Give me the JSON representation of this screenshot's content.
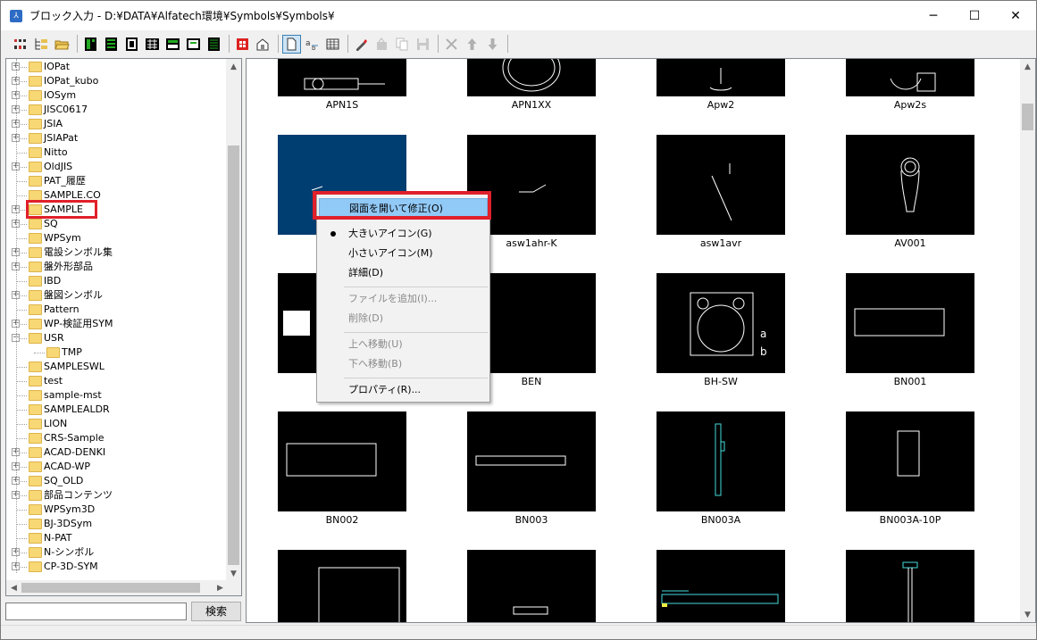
{
  "window": {
    "title": "ブロック入力 - D:¥DATA¥Alfatech環境¥Symbols¥Symbols¥",
    "minimize_glyph": "─",
    "maximize_glyph": "☐",
    "close_glyph": "✕"
  },
  "toolbar": {
    "buttons": [
      "tree-icon",
      "tree-folder-icon",
      "open-folder-icon",
      "green-grid-icon-1",
      "green-grid-icon-2",
      "frame-icon-1",
      "frame-icon-2",
      "frame-icon-3",
      "frame-icon-4",
      "red-symbol-icon",
      "property-icon",
      "large-icon-view-icon",
      "small-icon-view-icon",
      "detail-view-icon",
      "pen-icon",
      "cut-icon",
      "copy-icon",
      "save-icon",
      "delete-icon",
      "move-up-icon",
      "move-down-icon"
    ]
  },
  "tree": {
    "items": [
      {
        "label": "IOPat",
        "expandable": true
      },
      {
        "label": "IOPat_kubo",
        "expandable": true
      },
      {
        "label": "IOSym",
        "expandable": true
      },
      {
        "label": "JISC0617",
        "expandable": true
      },
      {
        "label": "JSIA",
        "expandable": true
      },
      {
        "label": "JSIAPat",
        "expandable": true
      },
      {
        "label": "Nitto",
        "expandable": false
      },
      {
        "label": "OldJIS",
        "expandable": true
      },
      {
        "label": "PAT_履歴",
        "expandable": false
      },
      {
        "label": "SAMPLE.CO",
        "expandable": false
      },
      {
        "label": "SAMPLE",
        "expandable": true
      },
      {
        "label": "SQ",
        "expandable": true
      },
      {
        "label": "WPSym",
        "expandable": false
      },
      {
        "label": "電設シンボル集",
        "expandable": true
      },
      {
        "label": "盤外形部品",
        "expandable": true
      },
      {
        "label": "IBD",
        "expandable": false
      },
      {
        "label": "盤図シンボル",
        "expandable": true
      },
      {
        "label": "Pattern",
        "expandable": false
      },
      {
        "label": "WP-検証用SYM",
        "expandable": true
      },
      {
        "label": "USR",
        "expandable": true,
        "expanded": true
      },
      {
        "label": "TMP",
        "expandable": false,
        "child": true
      },
      {
        "label": "SAMPLESWL",
        "expandable": false
      },
      {
        "label": "test",
        "expandable": false
      },
      {
        "label": "sample-mst",
        "expandable": false
      },
      {
        "label": "SAMPLEALDR",
        "expandable": false
      },
      {
        "label": "LION",
        "expandable": false
      },
      {
        "label": "CRS-Sample",
        "expandable": false
      },
      {
        "label": "ACAD-DENKI",
        "expandable": true
      },
      {
        "label": "ACAD-WP",
        "expandable": true
      },
      {
        "label": "SQ_OLD",
        "expandable": true
      },
      {
        "label": "部品コンテンツ",
        "expandable": true
      },
      {
        "label": "WPSym3D",
        "expandable": false
      },
      {
        "label": "BJ-3DSym",
        "expandable": false
      },
      {
        "label": "N-PAT",
        "expandable": false
      },
      {
        "label": "N-シンボル",
        "expandable": true
      },
      {
        "label": "CP-3D-SYM",
        "expandable": true
      }
    ],
    "highlighted": "SAMPLE"
  },
  "search": {
    "value": "",
    "button_label": "検索"
  },
  "icons": {
    "captions": [
      "APN1S",
      "APN1XX",
      "Apw2",
      "Apw2s",
      "",
      "asw1ahr-K",
      "asw1avr",
      "AV001",
      "",
      "BEN",
      "BH-SW",
      "BN001",
      "BN002",
      "BN003",
      "BN003A",
      "BN003A-10P",
      "",
      "",
      "",
      ""
    ],
    "selected_index": 4
  },
  "context_menu": {
    "items": [
      {
        "label": "図面を開いて修正(O)",
        "state": "hover"
      },
      {
        "label": "大きいアイコン(G)",
        "state": "checked"
      },
      {
        "label": "小さいアイコン(M)",
        "state": "normal"
      },
      {
        "label": "詳細(D)",
        "state": "normal"
      },
      {
        "label": "ファイルを追加(I)...",
        "state": "disabled"
      },
      {
        "label": "削除(D)",
        "state": "disabled"
      },
      {
        "label": "上へ移動(U)",
        "state": "disabled"
      },
      {
        "label": "下へ移動(B)",
        "state": "disabled"
      },
      {
        "label": "プロパティ(R)...",
        "state": "normal"
      }
    ]
  },
  "colors": {
    "highlight_red": "#e0202a",
    "menu_hover": "#91c9f7",
    "selected_tile": "#003d70",
    "folder": "#f8d775"
  }
}
